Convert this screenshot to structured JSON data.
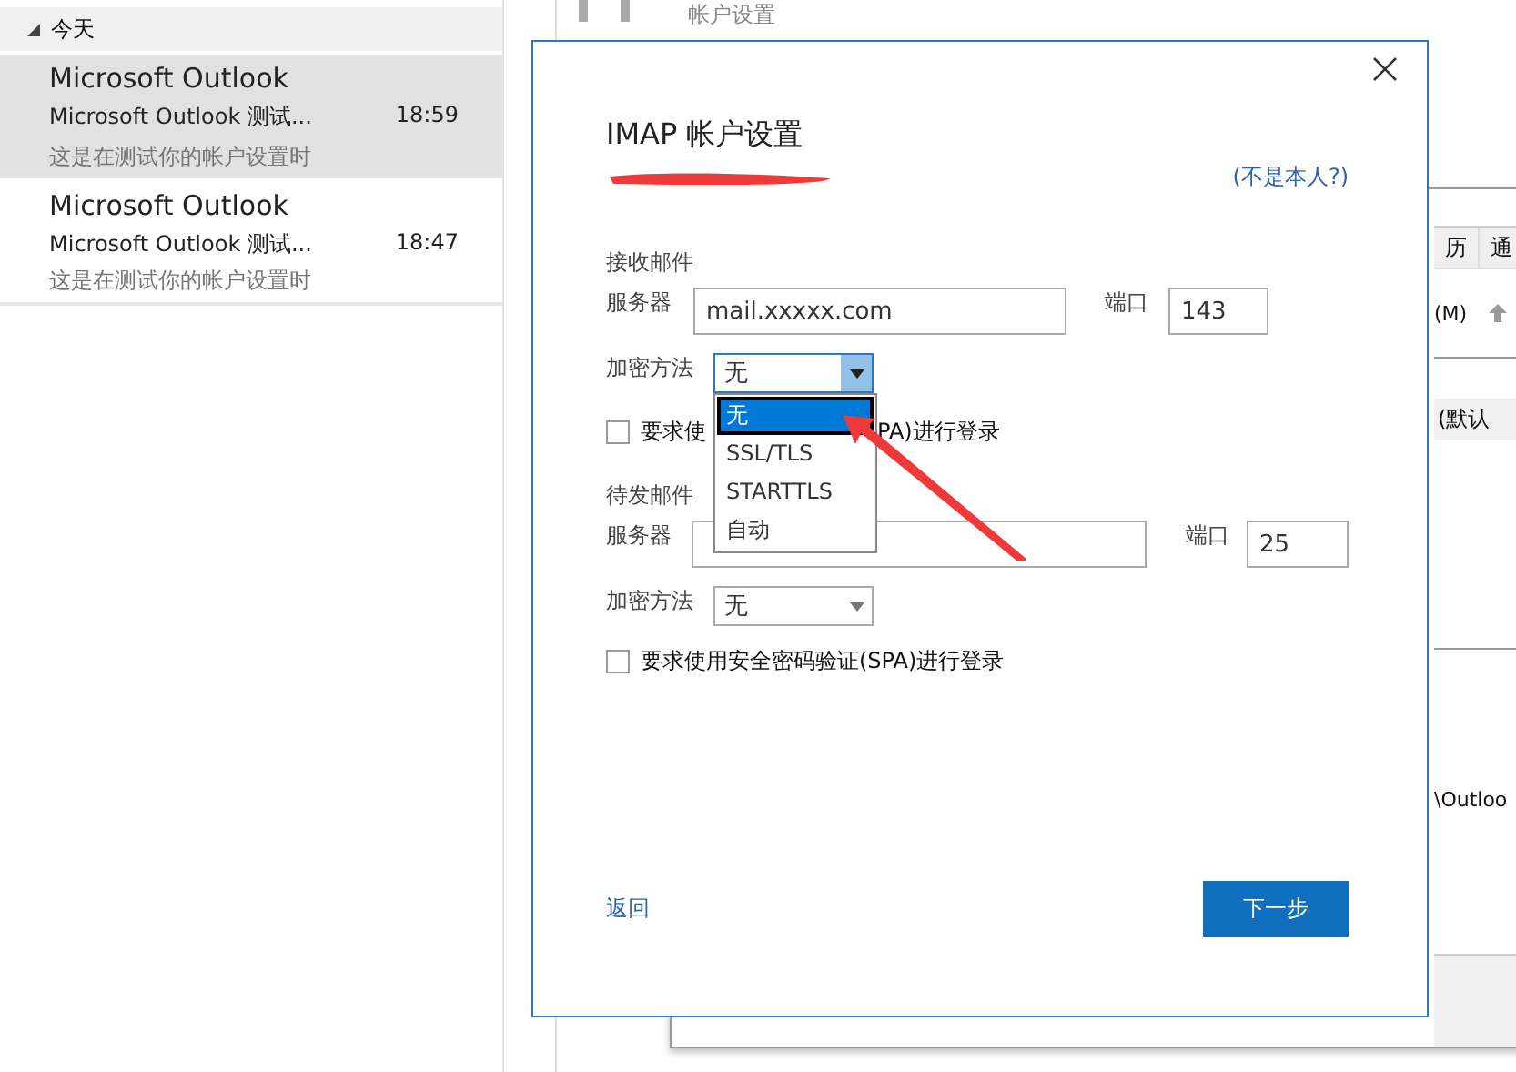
{
  "mail_list": {
    "group": {
      "label": "今天",
      "expanded": true
    },
    "items": [
      {
        "sender": "Microsoft Outlook",
        "subject": "Microsoft Outlook 测试...",
        "time": "18:59",
        "preview": "这是在测试你的帐户设置时",
        "selected": true
      },
      {
        "sender": "Microsoft Outlook",
        "subject": "Microsoft Outlook 测试...",
        "time": "18:47",
        "preview": "这是在测试你的帐户设置时",
        "selected": false
      }
    ]
  },
  "back_window": {
    "title": "帐户设置",
    "tabs": [
      "历",
      "通"
    ],
    "toolbar_text": "(M)",
    "row_text": "(默认",
    "path_text": "\\Outloo"
  },
  "dialog": {
    "title": "IMAP 帐户设置",
    "not_me_link": "(不是本人?)",
    "incoming": {
      "heading": "接收邮件",
      "server_label": "服务器",
      "server": "mail.xxxxx.com",
      "port_label": "端口",
      "port": "143",
      "encryption_label": "加密方法",
      "encryption": "无",
      "open": true,
      "options": [
        {
          "label": "无",
          "selected": true
        },
        {
          "label": "SSL/TLS",
          "selected": false
        },
        {
          "label": "STARTTLS",
          "selected": false
        },
        {
          "label": "自动",
          "selected": false
        }
      ],
      "spa_label_start": "要求使",
      "spa_label_end": "PA)进行登录",
      "spa_checked": false
    },
    "outgoing": {
      "heading": "待发邮件",
      "server_label": "服务器",
      "port_label": "端口",
      "port": "25",
      "encryption_label": "加密方法",
      "encryption": "无",
      "open": false,
      "spa_label": "要求使用安全密码验证(SPA)进行登录",
      "spa_checked": false
    },
    "back_link": "返回",
    "next_button": "下一步"
  }
}
